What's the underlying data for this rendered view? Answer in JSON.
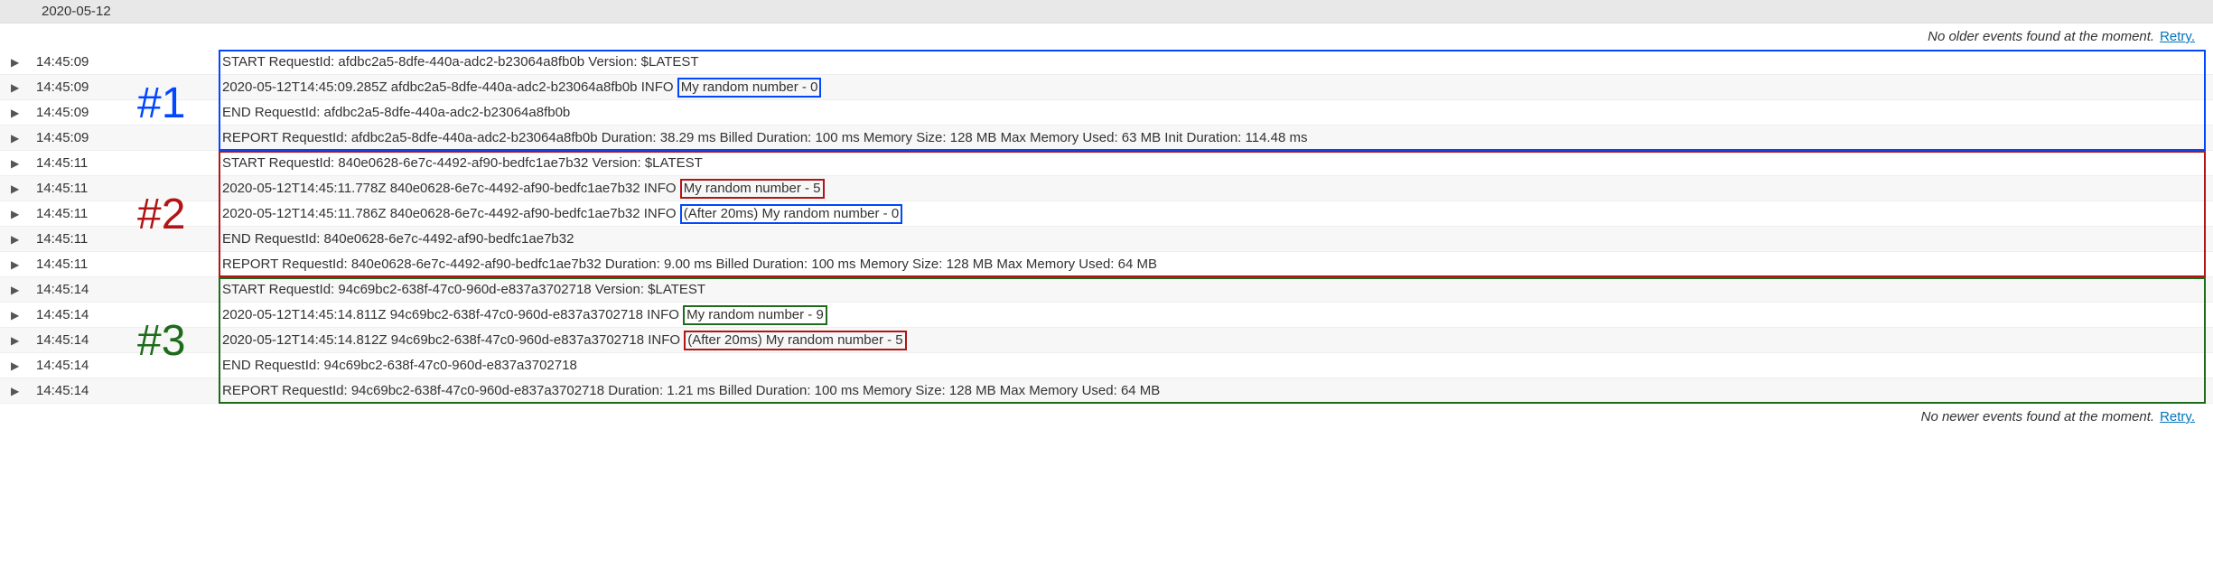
{
  "date_header": "2020-05-12",
  "top_notice": {
    "msg": "No older events found at the moment.",
    "retry": "Retry."
  },
  "bottom_notice": {
    "msg": "No newer events found at the moment.",
    "retry": "Retry."
  },
  "annotations": {
    "a1": "#1",
    "a2": "#2",
    "a3": "#3"
  },
  "colors": {
    "blue": "#0047ff",
    "red": "#b21515",
    "green": "#1d6b1b"
  },
  "rows": [
    {
      "time": "14:45:09",
      "pre": "START RequestId: afdbc2a5-8dfe-440a-adc2-b23064a8fb0b Version: $LATEST",
      "box": null,
      "post": ""
    },
    {
      "time": "14:45:09",
      "pre": "2020-05-12T14:45:09.285Z afdbc2a5-8dfe-440a-adc2-b23064a8fb0b INFO ",
      "box": {
        "text": "My random number - 0",
        "color": "blue"
      },
      "post": ""
    },
    {
      "time": "14:45:09",
      "pre": "END RequestId: afdbc2a5-8dfe-440a-adc2-b23064a8fb0b",
      "box": null,
      "post": ""
    },
    {
      "time": "14:45:09",
      "pre": "REPORT RequestId: afdbc2a5-8dfe-440a-adc2-b23064a8fb0b Duration: 38.29 ms Billed Duration: 100 ms Memory Size: 128 MB Max Memory Used: 63 MB Init Duration: 114.48 ms",
      "box": null,
      "post": ""
    },
    {
      "time": "14:45:11",
      "pre": "START RequestId: 840e0628-6e7c-4492-af90-bedfc1ae7b32 Version: $LATEST",
      "box": null,
      "post": ""
    },
    {
      "time": "14:45:11",
      "pre": "2020-05-12T14:45:11.778Z 840e0628-6e7c-4492-af90-bedfc1ae7b32 INFO ",
      "box": {
        "text": "My random number - 5",
        "color": "red"
      },
      "post": ""
    },
    {
      "time": "14:45:11",
      "pre": "2020-05-12T14:45:11.786Z 840e0628-6e7c-4492-af90-bedfc1ae7b32 INFO ",
      "box": {
        "text": "(After 20ms) My random number - 0",
        "color": "blue"
      },
      "post": ""
    },
    {
      "time": "14:45:11",
      "pre": "END RequestId: 840e0628-6e7c-4492-af90-bedfc1ae7b32",
      "box": null,
      "post": ""
    },
    {
      "time": "14:45:11",
      "pre": "REPORT RequestId: 840e0628-6e7c-4492-af90-bedfc1ae7b32 Duration: 9.00 ms Billed Duration: 100 ms Memory Size: 128 MB Max Memory Used: 64 MB",
      "box": null,
      "post": ""
    },
    {
      "time": "14:45:14",
      "pre": "START RequestId: 94c69bc2-638f-47c0-960d-e837a3702718 Version: $LATEST",
      "box": null,
      "post": ""
    },
    {
      "time": "14:45:14",
      "pre": "2020-05-12T14:45:14.811Z 94c69bc2-638f-47c0-960d-e837a3702718 INFO ",
      "box": {
        "text": "My random number - 9",
        "color": "green"
      },
      "post": ""
    },
    {
      "time": "14:45:14",
      "pre": "2020-05-12T14:45:14.812Z 94c69bc2-638f-47c0-960d-e837a3702718 INFO ",
      "box": {
        "text": "(After 20ms) My random number - 5",
        "color": "red"
      },
      "post": ""
    },
    {
      "time": "14:45:14",
      "pre": "END RequestId: 94c69bc2-638f-47c0-960d-e837a3702718",
      "box": null,
      "post": ""
    },
    {
      "time": "14:45:14",
      "pre": "REPORT RequestId: 94c69bc2-638f-47c0-960d-e837a3702718 Duration: 1.21 ms Billed Duration: 100 ms Memory Size: 128 MB Max Memory Used: 64 MB",
      "box": null,
      "post": ""
    }
  ]
}
